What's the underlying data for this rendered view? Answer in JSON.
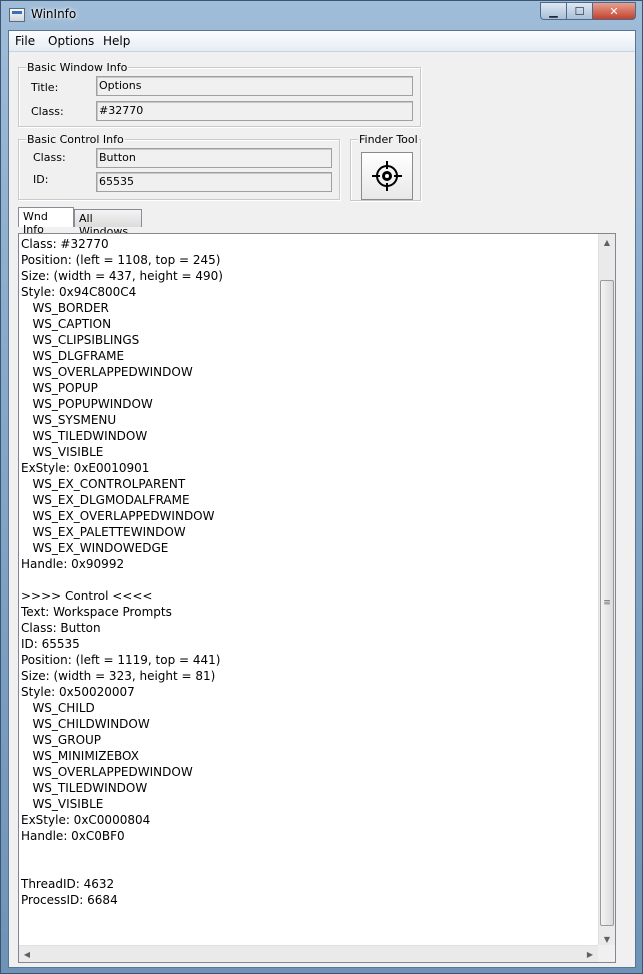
{
  "window": {
    "title": "WinInfo"
  },
  "menu": [
    "File",
    "Options",
    "Help"
  ],
  "basic_window": {
    "legend": "Basic Window Info",
    "title_label": "Title:",
    "title_value": "Options",
    "class_label": "Class:",
    "class_value": "#32770"
  },
  "basic_control": {
    "legend": "Basic Control Info",
    "class_label": "Class:",
    "class_value": "Button",
    "id_label": "ID:",
    "id_value": "65535"
  },
  "finder": {
    "legend": "Finder Tool",
    "icon": "crosshair-target-icon"
  },
  "tabs": [
    "Wnd Info",
    "All Windows"
  ],
  "lines": [
    "Class: #32770",
    "Position: (left = 1108, top = 245)",
    "Size: (width = 437, height = 490)",
    "Style: 0x94C800C4",
    "   WS_BORDER",
    "   WS_CAPTION",
    "   WS_CLIPSIBLINGS",
    "   WS_DLGFRAME",
    "   WS_OVERLAPPEDWINDOW",
    "   WS_POPUP",
    "   WS_POPUPWINDOW",
    "   WS_SYSMENU",
    "   WS_TILEDWINDOW",
    "   WS_VISIBLE",
    "ExStyle: 0xE0010901",
    "   WS_EX_CONTROLPARENT",
    "   WS_EX_DLGMODALFRAME",
    "   WS_EX_OVERLAPPEDWINDOW",
    "   WS_EX_PALETTEWINDOW",
    "   WS_EX_WINDOWEDGE",
    "Handle: 0x90992",
    "",
    ">>>> Control <<<<",
    "Text: Workspace Prompts",
    "Class: Button",
    "ID: 65535",
    "Position: (left = 1119, top = 441)",
    "Size: (width = 323, height = 81)",
    "Style: 0x50020007",
    "   WS_CHILD",
    "   WS_CHILDWINDOW",
    "   WS_GROUP",
    "   WS_MINIMIZEBOX",
    "   WS_OVERLAPPEDWINDOW",
    "   WS_TILEDWINDOW",
    "   WS_VISIBLE",
    "ExStyle: 0xC0000804",
    "Handle: 0xC0BF0",
    "",
    "",
    "ThreadID: 4632",
    "ProcessID: 6684"
  ]
}
